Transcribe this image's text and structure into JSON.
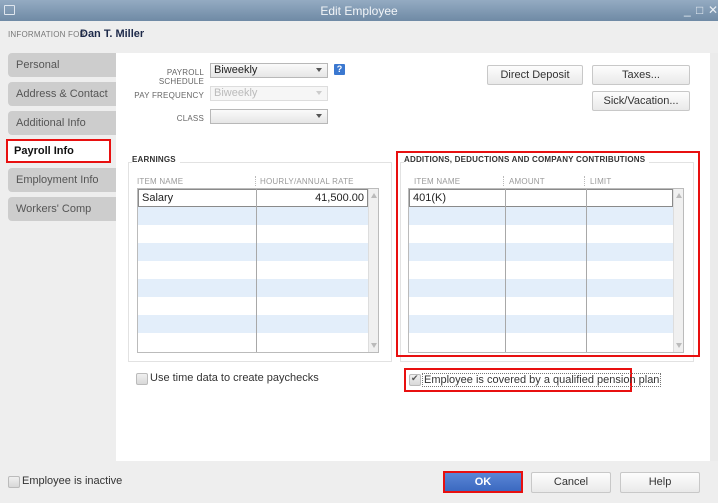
{
  "window": {
    "title": "Edit Employee",
    "controls": {
      "minimize": "_",
      "maximize": "□",
      "close": "✕"
    }
  },
  "header": {
    "info_for_label": "INFORMATION FOR",
    "employee_name": "Dan T. Miller"
  },
  "tabs": [
    {
      "label": "Personal",
      "active": false
    },
    {
      "label": "Address & Contact",
      "active": false
    },
    {
      "label": "Additional Info",
      "active": false
    },
    {
      "label": "Payroll Info",
      "active": true
    },
    {
      "label": "Employment Info",
      "active": false
    },
    {
      "label": "Workers' Comp",
      "active": false
    }
  ],
  "payroll": {
    "schedule_label": "PAYROLL SCHEDULE",
    "schedule_value": "Biweekly",
    "frequency_label": "PAY FREQUENCY",
    "frequency_value": "Biweekly",
    "class_label": "CLASS",
    "class_value": "",
    "help_icon": "?"
  },
  "buttons": {
    "direct_deposit": "Direct Deposit",
    "taxes": "Taxes...",
    "sick_vacation": "Sick/Vacation...",
    "ok": "OK",
    "cancel": "Cancel",
    "help": "Help"
  },
  "earnings": {
    "title": "EARNINGS",
    "columns": [
      "ITEM NAME",
      "HOURLY/ANNUAL RATE"
    ],
    "rows": [
      {
        "item": "Salary",
        "rate": "41,500.00"
      }
    ]
  },
  "additions": {
    "title": "ADDITIONS, DEDUCTIONS AND COMPANY CONTRIBUTIONS",
    "columns": [
      "ITEM NAME",
      "AMOUNT",
      "LIMIT"
    ],
    "rows": [
      {
        "item": "401(K)",
        "amount": "",
        "limit": ""
      }
    ]
  },
  "checkboxes": {
    "use_time_data": {
      "label": "Use time data to create paychecks",
      "checked": false
    },
    "pension_plan": {
      "label": "Employee is covered by a qualified pension plan",
      "checked": true
    },
    "inactive": {
      "label": "Employee is inactive",
      "checked": false
    }
  }
}
